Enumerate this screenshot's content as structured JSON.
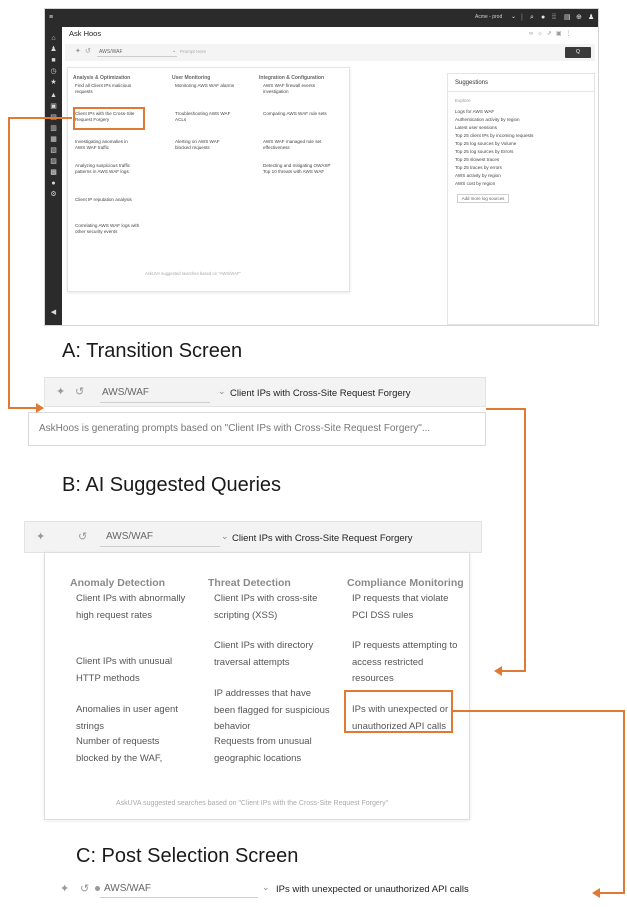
{
  "panelA": {
    "topbar": {
      "org": "Acme - prod",
      "icons": [
        "menu-icon",
        "chevron-down-icon",
        "search-icon",
        "help-icon",
        "apps-icon",
        "docs-icon",
        "globe-icon",
        "user-icon"
      ]
    },
    "title": "Ask Hoos",
    "title_icons": [
      "link-icon",
      "bug-icon",
      "share-icon",
      "save-icon",
      "more-icon"
    ],
    "source": "AWS/WAF",
    "prompt_placeholder": "Prompt Here",
    "search_label": "Q",
    "columns": [
      {
        "heading": "Analysis & Optimization",
        "items": [
          "Find all Client IPs malicious requests",
          "Client IPs with the Cross-Site Request Forgery",
          "Investigating anomalies in AWS WAF traffic",
          "Analyzing suspicious traffic patterns in AWS WAF logs",
          "Client IP reputation analysis",
          "Correlating AWS WAF logs with other security events"
        ]
      },
      {
        "heading": "User Monitoring",
        "items": [
          "Monitoring AWS WAF alarms",
          "Troubleshooting AWS WAF ACLs",
          "Alerting on AWS WAF blocked requests"
        ]
      },
      {
        "heading": "Integration & Configuration",
        "items": [
          "AWS WAF firewall events investigation",
          "Comparing AWS WAF rule sets",
          "AWS WAF managed rule set effectiveness",
          "Detecting and mitigating OWASP Top 10 threats with AWS WAF"
        ]
      }
    ],
    "footer": "AskUVA suggested searches based on \"AWS/WAF\"",
    "suggestions": {
      "title": "Suggestions",
      "explore": "Explore",
      "items": [
        "Logs for AWS WAF",
        "Authentication activity by region",
        "Latest user sessions",
        "Top 25 client IPs by incoming requests",
        "Top 25 log sources by Volume",
        "Top 25 log sources by Errors",
        "Top 25 slowest traces",
        "Top 25 traces by errors",
        "AWS activity by region",
        "AWS cost by region"
      ],
      "add_button": "Add more log sources"
    }
  },
  "headings": {
    "a": "A: Transition Screen",
    "b": "B: AI Suggested Queries",
    "c": "C: Post Selection Screen"
  },
  "panelB": {
    "source": "AWS/WAF",
    "query": "Client IPs with Cross-Site Request Forgery",
    "generating": "AskHoos is generating prompts based on \"Client IPs with Cross-Site Request Forgery\"..."
  },
  "panelC": {
    "source": "AWS/WAF",
    "query": "Client IPs with Cross-Site Request Forgery",
    "columns": [
      {
        "heading": "Anomaly Detection",
        "items": [
          "Client IPs with abnormally high request rates",
          "Client IPs with unusual HTTP methods",
          "Anomalies in user agent strings",
          "Number of requests blocked by the WAF,"
        ]
      },
      {
        "heading": "Threat Detection",
        "items": [
          "Client IPs with cross-site scripting (XSS)",
          "Client IPs with directory traversal attempts",
          "IP addresses that have been flagged for suspicious behavior",
          "Requests from unusual geographic locations"
        ]
      },
      {
        "heading": "Compliance Monitoring",
        "items": [
          "IP requests that violate PCI DSS rules",
          "IP requests attempting to access restricted resources",
          "IPs with unexpected or unauthorized API calls"
        ]
      }
    ],
    "footer": "AskUVA suggested searches based on \"Client IPs with the Cross-Site Request Forgery\""
  },
  "panelD": {
    "source": "AWS/WAF",
    "query": "IPs with unexpected or unauthorized API calls"
  },
  "colors": {
    "accent": "#e07a33",
    "dark": "#2b2b2b"
  }
}
